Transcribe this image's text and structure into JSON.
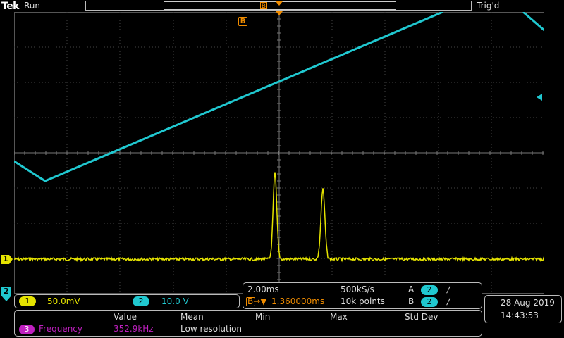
{
  "status": {
    "brand": "Tek",
    "run_state": "Run",
    "trigger_state": "Trig'd"
  },
  "markers": {
    "record_b": "B",
    "screen_b": "B",
    "ch1": "1",
    "ch2": "2"
  },
  "channels": [
    {
      "num": "1",
      "scale": "50.0mV",
      "color": "#e5e300"
    },
    {
      "num": "2",
      "scale": "10.0 V",
      "color": "#20c8d0"
    }
  ],
  "horizontal": {
    "timebase": "2.00ms",
    "sample_rate": "500kS/s",
    "delay_icon": "B→▼",
    "delay": "1.360000ms",
    "record_length": "10k points"
  },
  "triggers": [
    {
      "label": "A",
      "source": "2",
      "slope": "/"
    },
    {
      "label": "B",
      "source": "2",
      "slope": "/"
    }
  ],
  "datetime": {
    "date": "28 Aug 2019",
    "time": "14:43:53"
  },
  "measurement": {
    "headers": [
      "Value",
      "Mean",
      "Min",
      "Max",
      "Std Dev"
    ],
    "source": "3",
    "name": "Frequency",
    "value": "352.9kHz",
    "mean": "Low resolution",
    "color": "#c020c0"
  },
  "waveforms": {
    "ch2_ramp_color": "#20c8d0",
    "ch1_pulses_color": "#e5e300"
  }
}
